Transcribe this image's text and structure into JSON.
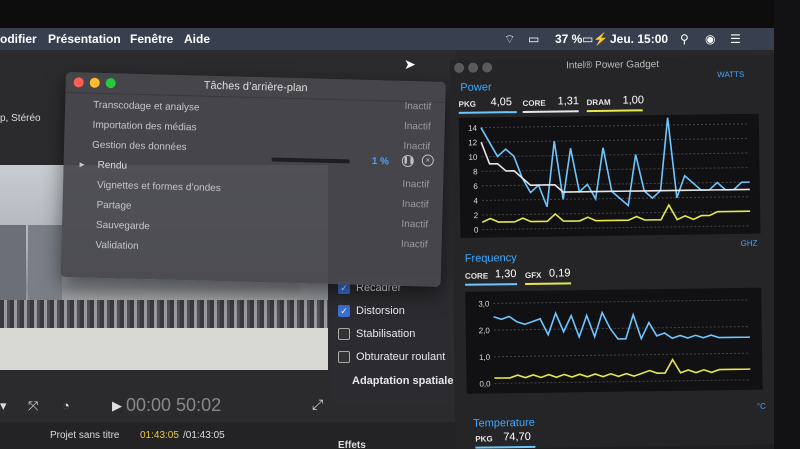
{
  "menubar": {
    "items": [
      "odifier",
      "Présentation",
      "Fenêtre",
      "Aide"
    ],
    "battery": "37 %",
    "clock": "Jeu. 15:00"
  },
  "fcp": {
    "audio_label": "p, Stéréo",
    "inspector": [
      {
        "label": "Recadrer",
        "checked": true
      },
      {
        "label": "Distorsion",
        "checked": true
      },
      {
        "label": "Stabilisation",
        "checked": false
      },
      {
        "label": "Obturateur roulant",
        "checked": false
      }
    ],
    "inspector_heading": "Adaptation spatiale",
    "timecode": "00:00 50:02",
    "project_title": "Projet sans titre",
    "project_time": "01:43:05",
    "project_total": "/01:43:05",
    "effects_label": "Effets"
  },
  "tasks": {
    "title": "Tâches d’arrière-plan",
    "items": [
      {
        "name": "Transcodage et analyse",
        "status": "Inactif"
      },
      {
        "name": "Importation des médias",
        "status": "Inactif"
      },
      {
        "name": "Gestion des données",
        "status": "Inactif"
      },
      {
        "name": "Rendu",
        "status": "1 %",
        "progress": 0.01
      },
      {
        "name": "Vignettes et formes d’ondes",
        "status": "Inactif"
      },
      {
        "name": "Partage",
        "status": "Inactif"
      },
      {
        "name": "Sauvegarde",
        "status": "Inactif"
      },
      {
        "name": "Validation",
        "status": "Inactif"
      }
    ]
  },
  "gadget": {
    "title": "Intel® Power Gadget",
    "power": {
      "title": "Power",
      "unit": "WATTS",
      "pkg_label": "PKG",
      "pkg": "4,05",
      "core_label": "CORE",
      "core": "1,31",
      "dram_label": "DRAM",
      "dram": "1,00",
      "ticks": [
        "14",
        "12",
        "10",
        "8",
        "6",
        "4",
        "2",
        "0"
      ]
    },
    "frequency": {
      "title": "Frequency",
      "unit": "GHZ",
      "core_label": "CORE",
      "core": "1,30",
      "gfx_label": "GFX",
      "gfx": "0,19",
      "ticks": [
        "3,0",
        "2,0",
        "1,0",
        "0,0"
      ]
    },
    "temperature": {
      "title": "Temperature",
      "unit": "°C",
      "pkg_label": "PKG",
      "pkg": "74,70"
    },
    "colors": {
      "pkg": "#6ec6ff",
      "core": "#e6e6e6",
      "dram": "#e8e84a",
      "accent": "#3fa8ff"
    }
  },
  "chart_data": [
    {
      "type": "line",
      "title": "Power",
      "ylim": [
        0,
        14
      ],
      "series": [
        {
          "name": "PKG",
          "values": [
            14,
            12,
            10,
            11,
            10,
            7,
            5,
            6,
            3,
            12,
            4,
            11,
            5,
            6,
            4,
            11,
            5,
            4,
            3,
            10,
            5,
            4,
            5,
            15,
            4,
            7,
            6,
            5,
            5,
            6,
            5,
            5,
            6,
            6
          ]
        },
        {
          "name": "CORE",
          "values": [
            12,
            9,
            9,
            8,
            8,
            7,
            6,
            6,
            6,
            6,
            5,
            5,
            5,
            5,
            5,
            5,
            5,
            5,
            5,
            5,
            5,
            5,
            5,
            5,
            5,
            5,
            5,
            5,
            5,
            5,
            5,
            5,
            5,
            5
          ]
        },
        {
          "name": "DRAM",
          "values": [
            1,
            1.5,
            1,
            1,
            1,
            1.5,
            1,
            1,
            1,
            2,
            1,
            1,
            1,
            1.5,
            1,
            1,
            1,
            1,
            1,
            1.5,
            1,
            1,
            1,
            3,
            1,
            1.5,
            1,
            1.5,
            1.5,
            2,
            2,
            2,
            2,
            2
          ]
        }
      ]
    },
    {
      "type": "line",
      "title": "Frequency",
      "ylim": [
        0,
        3
      ],
      "series": [
        {
          "name": "CORE",
          "values": [
            2.5,
            2.4,
            2.5,
            2.3,
            2.2,
            2.3,
            2.4,
            1.8,
            2.6,
            1.9,
            2.5,
            1.7,
            2.5,
            1.7,
            2.6,
            2.0,
            1.6,
            1.6,
            2.5,
            1.6,
            2.2,
            1.7,
            1.8,
            1.6,
            1.7,
            1.6,
            1.7,
            1.6,
            1.7,
            1.6,
            1.6,
            1.6,
            1.6,
            1.6
          ]
        },
        {
          "name": "GFX",
          "values": [
            0.2,
            0.2,
            0.2,
            0.3,
            0.2,
            0.3,
            0.2,
            0.3,
            0.2,
            0.3,
            0.2,
            0.3,
            0.2,
            0.3,
            0.2,
            0.3,
            0.2,
            0.3,
            0.2,
            0.3,
            0.4,
            0.3,
            0.3,
            0.8,
            0.3,
            0.4,
            0.3,
            0.4,
            0.3,
            0.4,
            0.4,
            0.4,
            0.4,
            0.4
          ]
        }
      ]
    }
  ]
}
